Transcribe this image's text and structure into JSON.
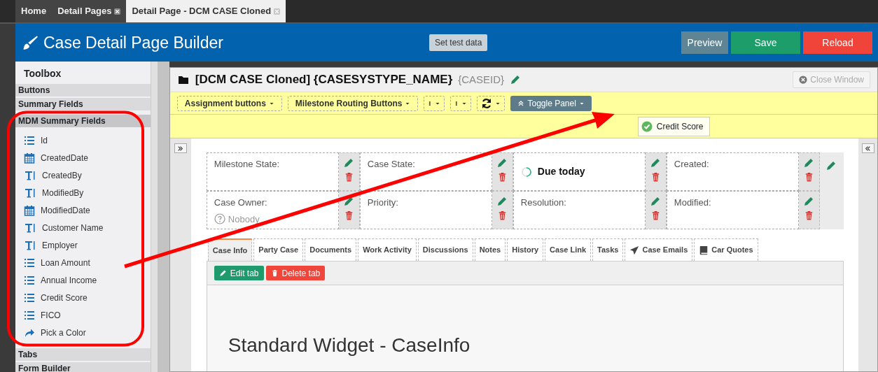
{
  "app_tabs": [
    {
      "label": "Home",
      "selected": false,
      "closable": false
    },
    {
      "label": "Detail Pages",
      "selected": false,
      "closable": true
    },
    {
      "label": "Detail Page - DCM CASE Cloned",
      "selected": true,
      "closable": true
    }
  ],
  "header": {
    "title": "Case Detail Page Builder",
    "test_button": "Set test data",
    "actions": [
      {
        "label": "Preview",
        "kind": "neutral"
      },
      {
        "label": "Save",
        "kind": "success"
      },
      {
        "label": "Reload",
        "kind": "danger"
      }
    ]
  },
  "toolbox": {
    "title": "Toolbox",
    "sections": [
      {
        "label": "Buttons",
        "expanded": false
      },
      {
        "label": "Summary Fields",
        "expanded": false
      },
      {
        "label": "MDM Summary Fields",
        "expanded": true,
        "items": [
          {
            "label": "Id",
            "kind": "number"
          },
          {
            "label": "CreatedDate",
            "kind": "date"
          },
          {
            "label": "CreatedBy",
            "kind": "text"
          },
          {
            "label": "ModifiedBy",
            "kind": "text"
          },
          {
            "label": "ModifiedDate",
            "kind": "date"
          },
          {
            "label": "Customer Name",
            "kind": "text"
          },
          {
            "label": "Employer",
            "kind": "text"
          },
          {
            "label": "Loan Amount",
            "kind": "number"
          },
          {
            "label": "Annual Income",
            "kind": "number"
          },
          {
            "label": "Credit Score",
            "kind": "number"
          },
          {
            "label": "FICO",
            "kind": "number"
          },
          {
            "label": "Pick a Color",
            "kind": "share"
          }
        ]
      },
      {
        "label": "Tabs",
        "expanded": false
      },
      {
        "label": "Form Builder",
        "expanded": false
      }
    ]
  },
  "panel": {
    "title": "[DCM CASE Cloned] {CASESYSTYPE_NAME}",
    "subtitle": "{CASEID}",
    "close_button": {
      "label": "Close Window",
      "disabled": true
    }
  },
  "toolbar": [
    {
      "kind": "dropdown",
      "label": "Assignment buttons"
    },
    {
      "kind": "dropdown",
      "label": "Milestone Routing Buttons"
    },
    {
      "kind": "dots"
    },
    {
      "kind": "dots"
    },
    {
      "kind": "refresh"
    },
    {
      "kind": "toggle",
      "label": "Toggle Panel"
    }
  ],
  "dropped_field": "Credit Score",
  "summary": [
    {
      "kind": "field",
      "label": "Milestone State:"
    },
    {
      "kind": "field",
      "label": "Case State:"
    },
    {
      "kind": "status",
      "label": "Due today"
    },
    {
      "kind": "field",
      "label": "Created:"
    },
    {
      "kind": "field",
      "label": "Case Owner:",
      "value": "Nobody"
    },
    {
      "kind": "field",
      "label": "Priority:"
    },
    {
      "kind": "field",
      "label": "Resolution:"
    },
    {
      "kind": "field",
      "label": "Modified:"
    }
  ],
  "tabs": [
    {
      "label": "Case Info",
      "selected": true
    },
    {
      "label": "Party Case",
      "selected": false
    },
    {
      "label": "Documents",
      "selected": false
    },
    {
      "label": "Work Activity",
      "selected": false
    },
    {
      "label": "Discussions",
      "selected": false
    },
    {
      "label": "Notes",
      "selected": false
    },
    {
      "label": "History",
      "selected": false
    },
    {
      "label": "Case Link",
      "selected": false
    },
    {
      "label": "Tasks",
      "selected": false
    },
    {
      "label": "Case Emails",
      "selected": false,
      "kind": "email"
    },
    {
      "label": "Car Quotes",
      "selected": false,
      "kind": "book"
    }
  ],
  "tab_actions": [
    {
      "label": "Edit tab",
      "kind": "edit"
    },
    {
      "label": "Delete tab",
      "kind": "delete"
    }
  ],
  "widget_title": "Standard Widget - CaseInfo"
}
